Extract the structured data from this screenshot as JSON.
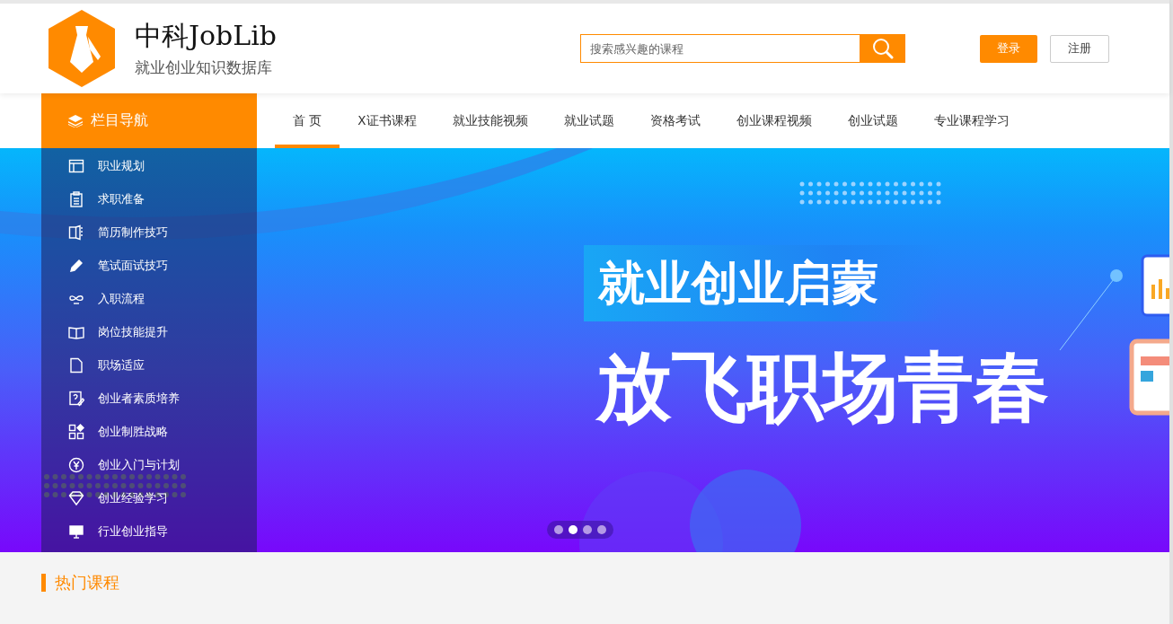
{
  "header": {
    "logo_title": "中科JobLib",
    "logo_subtitle": "就业创业知识数据库",
    "search": {
      "placeholder": "搜索感兴趣的课程"
    },
    "buttons": [
      {
        "label": "登录",
        "kind": "primary"
      },
      {
        "label": "注册",
        "kind": "outline"
      }
    ]
  },
  "sidebar": {
    "title": "栏目导航",
    "items": [
      {
        "label": "职业规划"
      },
      {
        "label": "求职准备"
      },
      {
        "label": "简历制作技巧"
      },
      {
        "label": "笔试面试技巧"
      },
      {
        "label": "入职流程"
      },
      {
        "label": "岗位技能提升"
      },
      {
        "label": "职场适应"
      },
      {
        "label": "创业者素质培养"
      },
      {
        "label": "创业制胜战略"
      },
      {
        "label": "创业入门与计划"
      },
      {
        "label": "创业经验学习"
      },
      {
        "label": "行业创业指导"
      }
    ]
  },
  "nav": [
    {
      "label": "首 页",
      "selected": true
    },
    {
      "label": "X证书课程",
      "selected": false
    },
    {
      "label": "就业技能视频",
      "selected": false
    },
    {
      "label": "就业试题",
      "selected": false
    },
    {
      "label": "资格考试",
      "selected": false
    },
    {
      "label": "创业课程视频",
      "selected": false
    },
    {
      "label": "创业试题",
      "selected": false
    },
    {
      "label": "专业课程学习",
      "selected": false
    }
  ],
  "banner": {
    "headline": "就业创业启蒙",
    "slogan": "放飞职场青春",
    "dots": [
      {
        "selected": false
      },
      {
        "selected": true
      },
      {
        "selected": false
      },
      {
        "selected": false
      }
    ]
  },
  "section": {
    "title": "热门课程"
  }
}
